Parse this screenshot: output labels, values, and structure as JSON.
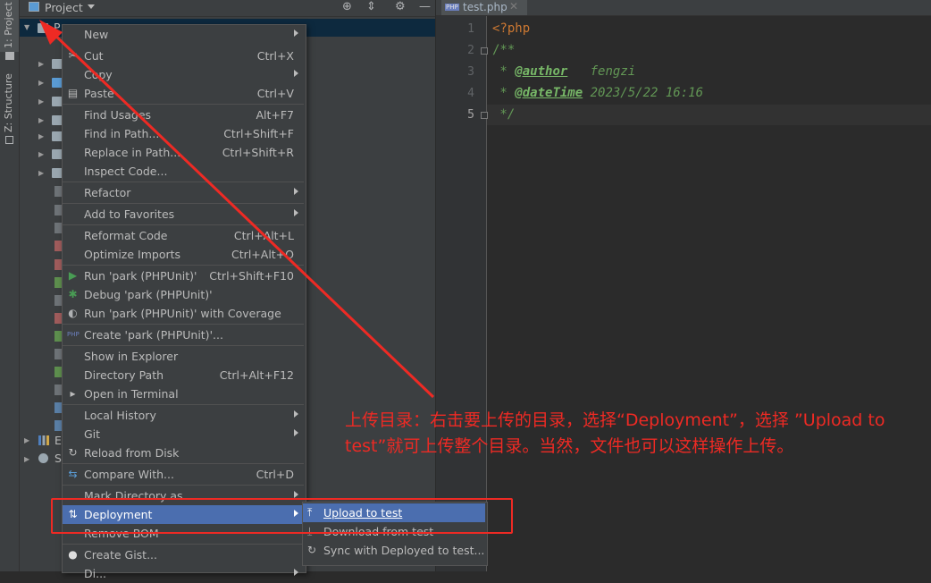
{
  "tool_strip": {
    "project_tab": "1: Project",
    "structure_tab": "Z: Structure"
  },
  "project_panel": {
    "title": "Project",
    "root_label": "P",
    "bottom_items": [
      "E",
      "S"
    ]
  },
  "editor": {
    "tab_label": "test.php",
    "tab_badge": "PHP",
    "lines": [
      {
        "num": "1",
        "text": "<?php"
      },
      {
        "num": "2",
        "text": "/**"
      },
      {
        "num": "3",
        "tag": "@author",
        "value": "fengzi"
      },
      {
        "num": "4",
        "tag": "@dateTime",
        "value": "2023/5/22 16:16"
      },
      {
        "num": "5",
        "text": " */"
      }
    ],
    "line3_prefix": " * ",
    "line4_prefix": " * "
  },
  "menu": {
    "items": [
      {
        "label": "New",
        "shortcut": "",
        "submenu": true
      },
      {
        "label": "Cut",
        "shortcut": "Ctrl+X",
        "icon": "cut-icon"
      },
      {
        "label": "Copy",
        "shortcut": "",
        "submenu": true
      },
      {
        "label": "Paste",
        "shortcut": "Ctrl+V",
        "icon": "paste-icon"
      },
      {
        "label": "Find Usages",
        "shortcut": "Alt+F7"
      },
      {
        "label": "Find in Path...",
        "shortcut": "Ctrl+Shift+F"
      },
      {
        "label": "Replace in Path...",
        "shortcut": "Ctrl+Shift+R"
      },
      {
        "label": "Inspect Code...",
        "shortcut": ""
      },
      {
        "label": "Refactor",
        "shortcut": "",
        "submenu": true
      },
      {
        "label": "Add to Favorites",
        "shortcut": "",
        "submenu": true
      },
      {
        "label": "Reformat Code",
        "shortcut": "Ctrl+Alt+L"
      },
      {
        "label": "Optimize Imports",
        "shortcut": "Ctrl+Alt+O"
      },
      {
        "label": "Run 'park (PHPUnit)'",
        "shortcut": "Ctrl+Shift+F10",
        "icon": "run-icon"
      },
      {
        "label": "Debug 'park (PHPUnit)'",
        "shortcut": "",
        "icon": "debug-icon"
      },
      {
        "label": "Run 'park (PHPUnit)' with Coverage",
        "shortcut": "",
        "icon": "coverage-icon"
      },
      {
        "label": "Create 'park (PHPUnit)'...",
        "shortcut": "",
        "icon": "php-config-icon"
      },
      {
        "label": "Show in Explorer",
        "shortcut": ""
      },
      {
        "label": "Directory Path",
        "shortcut": "Ctrl+Alt+F12"
      },
      {
        "label": "Open in Terminal",
        "shortcut": "",
        "icon": "terminal-icon"
      },
      {
        "label": "Local History",
        "shortcut": "",
        "submenu": true
      },
      {
        "label": "Git",
        "shortcut": "",
        "submenu": true
      },
      {
        "label": "Reload from Disk",
        "shortcut": "",
        "icon": "reload-icon"
      },
      {
        "label": "Compare With...",
        "shortcut": "Ctrl+D",
        "icon": "compare-icon"
      },
      {
        "label": "Mark Directory as",
        "shortcut": "",
        "submenu": true
      },
      {
        "label": "Deployment",
        "shortcut": "",
        "submenu": true,
        "icon": "deployment-icon",
        "highlighted": true
      },
      {
        "label": "Remove BOM",
        "shortcut": ""
      },
      {
        "label": "Create Gist...",
        "shortcut": "",
        "icon": "github-icon"
      },
      {
        "label": "Di...",
        "shortcut": "",
        "submenu": true
      }
    ]
  },
  "submenu": {
    "items": [
      {
        "label": "Upload to test",
        "icon": "upload-icon",
        "highlighted": true
      },
      {
        "label": "Download from test",
        "icon": "download-icon"
      },
      {
        "label": "Sync with Deployed to test...",
        "icon": "sync-icon"
      }
    ]
  },
  "annotation": {
    "text": "上传目录：右击要上传的目录，选择“Deployment”，选择 ”Upload to test”就可上传整个目录。当然，文件也可以这样操作上传。",
    "color": "#ee2a24"
  },
  "colors": {
    "highlight": "#4b6eaf",
    "panel": "#3c3f41",
    "editor_bg": "#2b2b2b",
    "keyword": "#cc7832",
    "doc_comment": "#629755",
    "doc_tag": "#77b767"
  }
}
